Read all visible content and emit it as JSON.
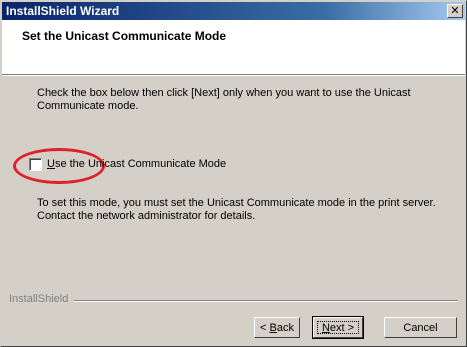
{
  "window": {
    "title": "InstallShield Wizard",
    "close_glyph": "✕"
  },
  "header": {
    "title": "Set the Unicast Communicate Mode"
  },
  "content": {
    "description": "Check the box below then click [Next] only when you want to use the Unicast Communicate mode.",
    "checkbox": {
      "label_prefix": "",
      "label_mnemonic": "U",
      "label_rest": "se the Unicast Communicate Mode",
      "checked": false
    },
    "note": "To set this mode, you must set the Unicast Communicate mode in the print server. Contact the network administrator for details."
  },
  "footer": {
    "brand": "InstallShield",
    "back_prefix": "< ",
    "back_mnemonic": "B",
    "back_rest": "ack",
    "next_mnemonic": "N",
    "next_rest": "ext >",
    "cancel_label": "Cancel"
  },
  "colors": {
    "highlight_ring": "#e0202a",
    "titlebar_start": "#0a246a",
    "titlebar_end": "#a6caf0"
  }
}
